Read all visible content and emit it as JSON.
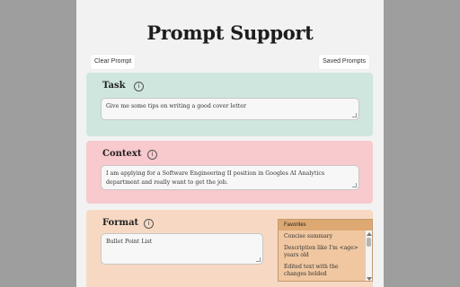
{
  "header": {
    "title": "Prompt Support"
  },
  "toolbar": {
    "clear_label": "Clear Prompt",
    "saved_label": "Saved Prompts"
  },
  "task": {
    "label": "Task",
    "value": "Give me some tips on writing a good cover letter"
  },
  "context": {
    "label": "Context",
    "value": "I am applying for a Software Engineering II position in Googles AI Analytics department and really want to get the job."
  },
  "format": {
    "label": "Format",
    "value": "Bullet Point List",
    "favorites": {
      "header": "Favorites",
      "items": [
        "Concise summary",
        "Description like I'm <age> years old",
        "Edited text with the changes bolded"
      ]
    }
  },
  "icons": {
    "info": "info-icon"
  },
  "colors": {
    "task_bg": "#cfe6df",
    "context_bg": "#f8c9cd",
    "format_bg": "#f7d9c3",
    "favorites_header": "#dea873"
  }
}
